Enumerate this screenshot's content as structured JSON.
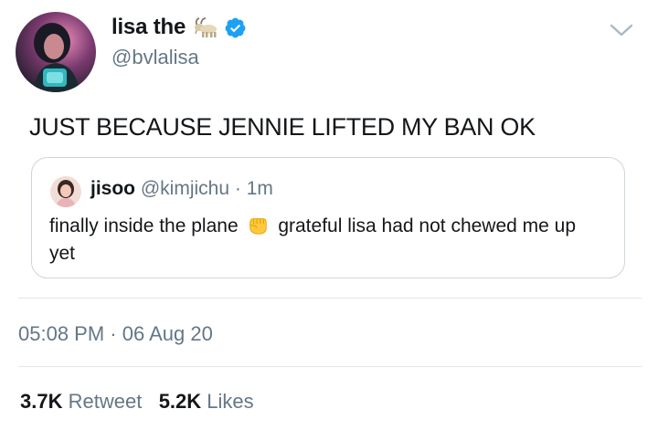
{
  "author": {
    "display_name": "lisa the",
    "handle": "@bvlalisa",
    "badge_emoji": "goat-emoji",
    "verified_icon": "verified-badge-icon",
    "avatar_icon": "user-avatar"
  },
  "tweet": {
    "text": "JUST BECAUSE JENNIE LIFTED MY BAN OK"
  },
  "quoted_tweet": {
    "display_name": "jisoo",
    "handle_and_time": "@kimjichu · 1m",
    "text_part1": "finally inside the plane",
    "emoji": "raised-fist-emoji",
    "text_part2": "grateful lisa had not chewed me up yet"
  },
  "meta": {
    "timestamp": "05:08 PM · 06 Aug 20"
  },
  "stats": {
    "retweets": "3.7K",
    "retweets_label": "Retweet",
    "likes": "5.2K",
    "likes_label": "Likes"
  },
  "colors": {
    "text": "#14171a",
    "secondary": "#657786",
    "border": "#ccd6dd",
    "verified": "#1da1f2"
  }
}
